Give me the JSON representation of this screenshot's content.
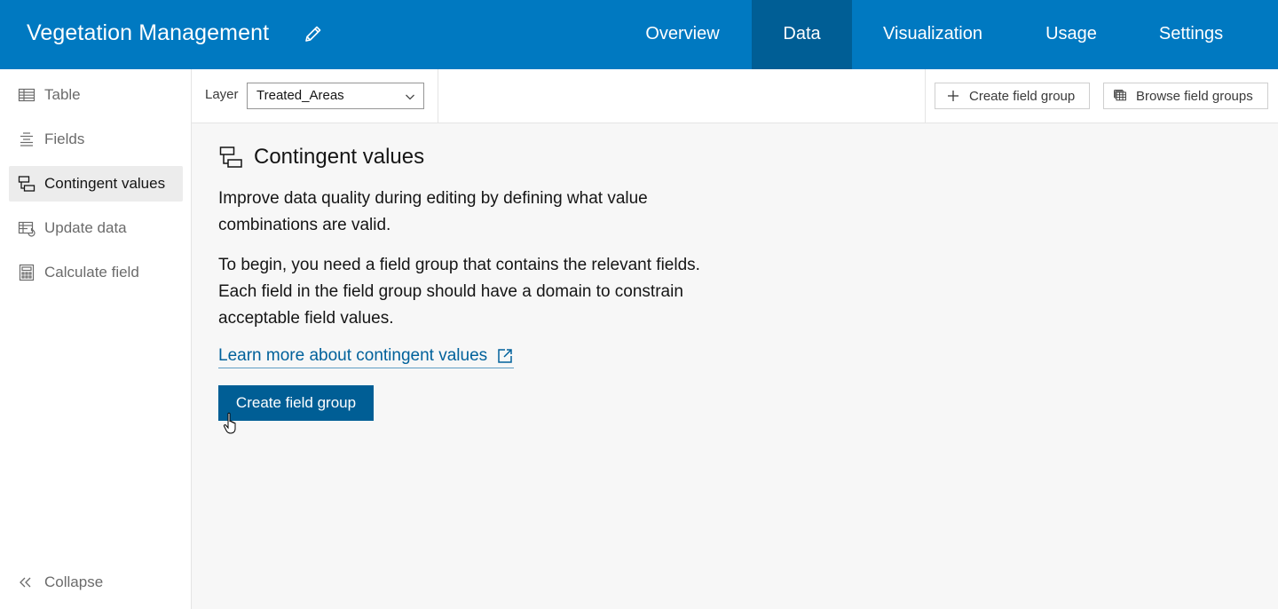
{
  "header": {
    "app_title": "Vegetation Management",
    "tabs": [
      {
        "label": "Overview",
        "active": false
      },
      {
        "label": "Data",
        "active": true
      },
      {
        "label": "Visualization",
        "active": false
      },
      {
        "label": "Usage",
        "active": false
      },
      {
        "label": "Settings",
        "active": false
      }
    ],
    "colors": {
      "bar": "#0079c1",
      "active_tab": "#005e95"
    }
  },
  "sidebar": {
    "items": [
      {
        "label": "Table",
        "icon": "table-icon",
        "active": false
      },
      {
        "label": "Fields",
        "icon": "fields-icon",
        "active": false
      },
      {
        "label": "Contingent values",
        "icon": "contingent-values-icon",
        "active": true
      },
      {
        "label": "Update data",
        "icon": "update-data-icon",
        "active": false
      },
      {
        "label": "Calculate field",
        "icon": "calculator-icon",
        "active": false
      }
    ],
    "collapse_label": "Collapse"
  },
  "toolbar": {
    "layer_label": "Layer",
    "layer_value": "Treated_Areas",
    "create_field_group_label": "Create field group",
    "browse_field_groups_label": "Browse field groups"
  },
  "main": {
    "heading": "Contingent values",
    "paragraph1": "Improve data quality during editing by defining what value combinations are valid.",
    "paragraph2": "To begin, you need a field group that contains the relevant fields. Each field in the field group should have a domain to constrain acceptable field values.",
    "learn_more_label": "Learn more about contingent values",
    "primary_button_label": "Create field group",
    "colors": {
      "primary_button": "#005e95",
      "link": "#00619b"
    }
  }
}
